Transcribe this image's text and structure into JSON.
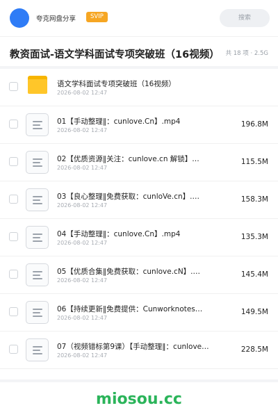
{
  "header": {
    "brand": "夸克网盘分享",
    "badge": "SVIP",
    "search_label": "搜索"
  },
  "folder": {
    "title": "教资面试-语文学科面试专项突破班（16视频）",
    "meta": "共 18 项 · 2.5G"
  },
  "items": [
    {
      "type": "folder",
      "name": "语文学科面试专项突破班（16视频）",
      "date": "2026-08-02 12:47",
      "size": ""
    },
    {
      "type": "file",
      "name": "01【手动整理‖：cunlove.Cn】.mp4",
      "date": "2026-08-02 12:47",
      "size": "196.8M"
    },
    {
      "type": "file",
      "name": "02【优质资源‖关注：cunlove.cn 解锁】…",
      "date": "2026-08-02 12:47",
      "size": "115.5M"
    },
    {
      "type": "file",
      "name": "03【良心整理‖免费获取：cunloVe.cn】.…",
      "date": "2026-08-02 12:47",
      "size": "158.3M"
    },
    {
      "type": "file",
      "name": "04【手动整理‖：cunlove.Cn】.mp4",
      "date": "2026-08-02 12:47",
      "size": "135.3M"
    },
    {
      "type": "file",
      "name": "05【优质合集‖免费获取：cunlove.cN】.…",
      "date": "2026-08-02 12:47",
      "size": "145.4M"
    },
    {
      "type": "file",
      "name": "06【持续更新‖免费提供：Cunworknotes…",
      "date": "2026-08-02 12:47",
      "size": "149.5M"
    },
    {
      "type": "file",
      "name": "07（视频错标第9课）【手动整理‖：cunlove…",
      "date": "2026-08-02 12:47",
      "size": "228.5M"
    }
  ],
  "watermark": "miosou.cc",
  "colors": {
    "avatar": "#2f7cf6",
    "badge": "#f6a623",
    "folder": "#ffc629",
    "watermark": "#2bb45a"
  },
  "icons": {
    "folder": "folder-icon",
    "file": "file-lines-icon"
  }
}
